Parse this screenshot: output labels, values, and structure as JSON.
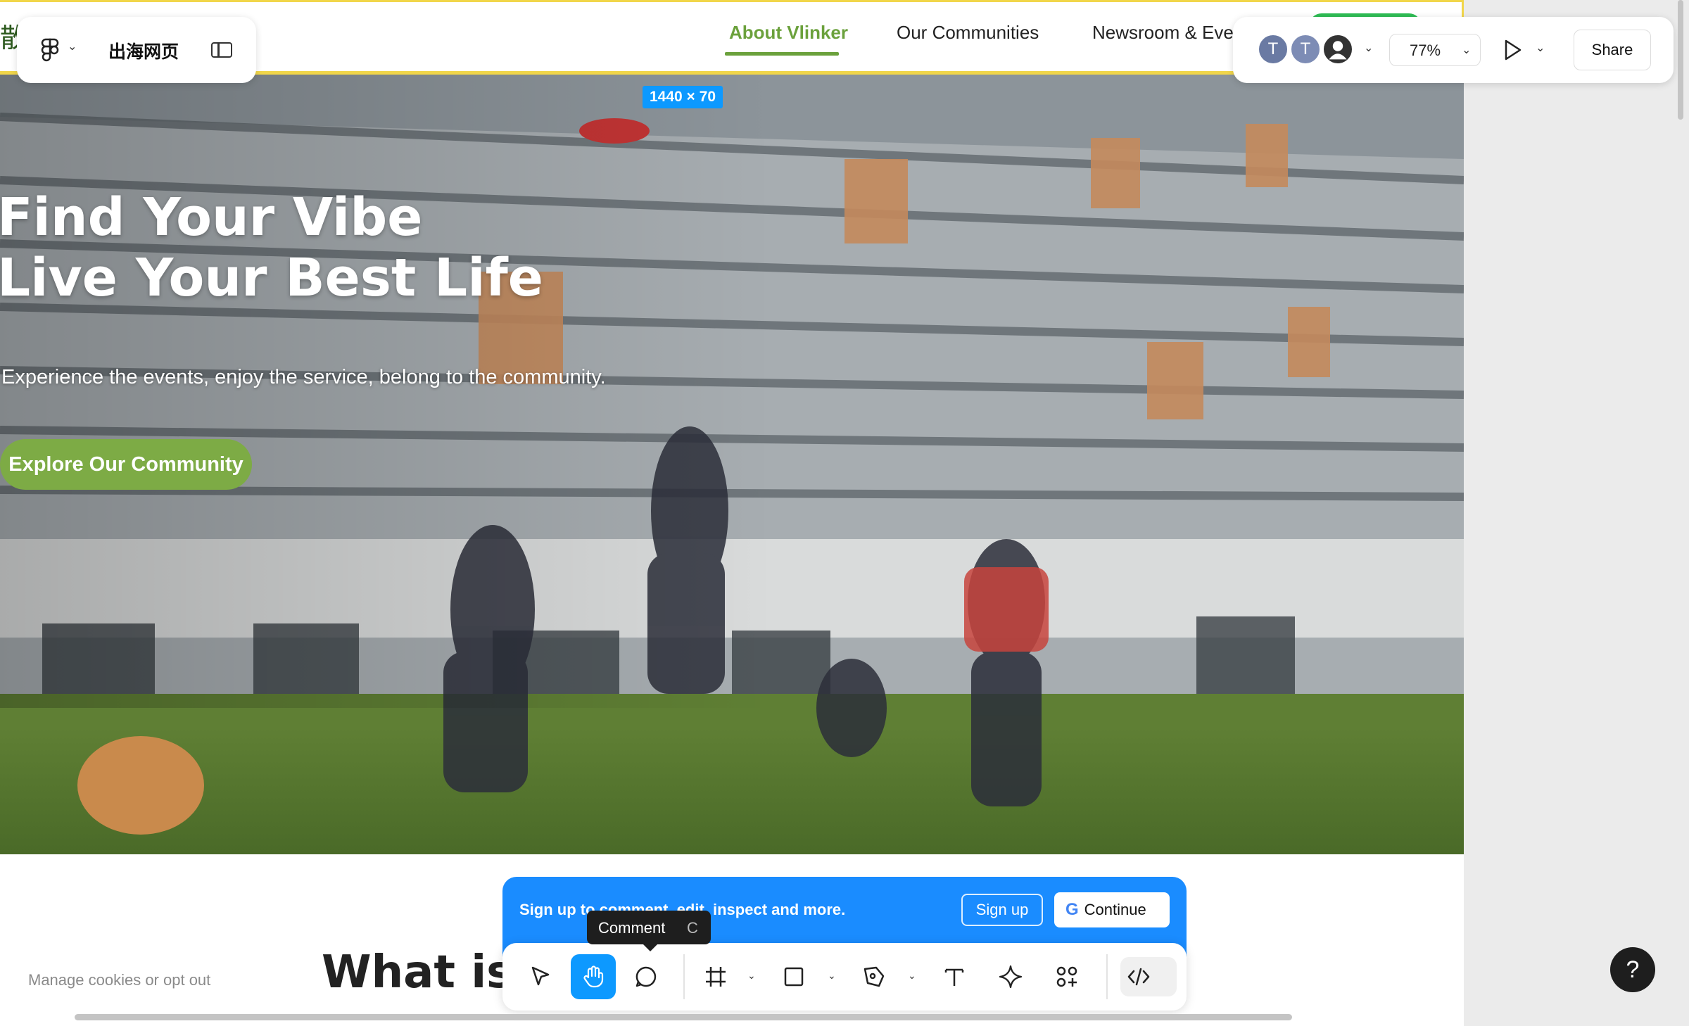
{
  "app": {
    "file_name": "出海网页",
    "zoom": "77%",
    "share_label": "Share",
    "frame_size_label": "1440 × 70",
    "avatars": [
      "T",
      "T",
      ""
    ]
  },
  "site": {
    "logo_glyph": "散",
    "nav": [
      "About Vlinker",
      "Our Communities",
      "Newsroom & Events"
    ],
    "hero": {
      "title_line1": "Find Your Vibe",
      "title_line2": "Live Your Best Life",
      "subtitle": "Experience the events, enjoy the service, belong to the community.",
      "cta": "Explore Our Community"
    },
    "section_title": "What is Vlinker",
    "cookies": "Manage cookies or opt out"
  },
  "signup": {
    "text": "Sign up to comment, edit, inspect and more.",
    "signup_button": "Sign up",
    "continue_button": "Continue",
    "google_glyph": "G"
  },
  "tooltip": {
    "label": "Comment",
    "shortcut": "C"
  },
  "toolbar": {
    "tools": [
      "move-tool",
      "hand-tool",
      "comment-tool",
      "frame-tool",
      "shape-tool",
      "pen-tool",
      "text-tool",
      "actions-tool",
      "assets-tool",
      "dev-mode-tool"
    ],
    "active_tool": "hand-tool"
  },
  "help": "?",
  "colors": {
    "accent": "#0d99ff",
    "brand_green": "#6ba13c",
    "cta_green": "#7dab45",
    "nav_yellow": "#f1d64a"
  }
}
